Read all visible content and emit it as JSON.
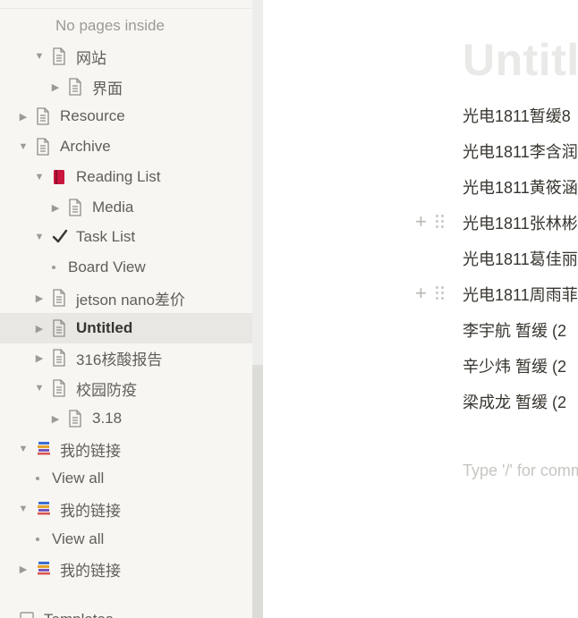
{
  "sidebar": {
    "rows": [
      {
        "label": "No pages inside",
        "indent": 62,
        "type": "text",
        "muted": true
      },
      {
        "label": "网站",
        "indent": 38,
        "type": "page",
        "tri": "▼"
      },
      {
        "label": "界面",
        "indent": 56,
        "type": "page",
        "tri": "▶"
      },
      {
        "label": "Resource",
        "indent": 20,
        "type": "page",
        "tri": "▶"
      },
      {
        "label": "Archive",
        "indent": 20,
        "type": "page",
        "tri": "▼"
      },
      {
        "label": "Reading List",
        "indent": 38,
        "type": "book",
        "tri": "▼"
      },
      {
        "label": "Media",
        "indent": 56,
        "type": "page",
        "tri": "▶"
      },
      {
        "label": "Task List",
        "indent": 38,
        "type": "check",
        "tri": "▼"
      },
      {
        "label": "Board View",
        "indent": 58,
        "type": "dot"
      },
      {
        "label": "jetson nano差价",
        "indent": 38,
        "type": "page",
        "tri": "▶"
      },
      {
        "label": "Untitled",
        "indent": 38,
        "type": "page",
        "tri": "▶",
        "selected": true
      },
      {
        "label": "316核酸报告",
        "indent": 38,
        "type": "page",
        "tri": "▶"
      },
      {
        "label": "校园防疫",
        "indent": 38,
        "type": "page",
        "tri": "▼"
      },
      {
        "label": "3.18",
        "indent": 56,
        "type": "page",
        "tri": "▶"
      },
      {
        "label": "我的链接",
        "indent": 20,
        "type": "books",
        "tri": "▼"
      },
      {
        "label": "View all",
        "indent": 40,
        "type": "dot"
      },
      {
        "label": "我的链接",
        "indent": 20,
        "type": "books",
        "tri": "▼"
      },
      {
        "label": "View all",
        "indent": 40,
        "type": "dot"
      },
      {
        "label": "我的链接",
        "indent": 20,
        "type": "books",
        "tri": "▶"
      }
    ],
    "bottom_label": "Templates"
  },
  "main": {
    "title": "Untitled",
    "lines": [
      "光电1811暂缓8",
      "光电1811李含润",
      "光电1811黄筱涵",
      "光电1811张林彬",
      "光电1811葛佳丽",
      "光电1811周雨菲",
      "李宇航 暂缓 (2",
      "辛少炜 暂缓 (2",
      "梁成龙 暂缓 (2"
    ],
    "placeholder": "Type '/' for commands"
  },
  "icons": [
    "chevron-down-icon",
    "chevron-right-icon",
    "page-icon",
    "book-icon",
    "check-icon",
    "books-icon",
    "plus-icon",
    "drag-handle-icon"
  ]
}
